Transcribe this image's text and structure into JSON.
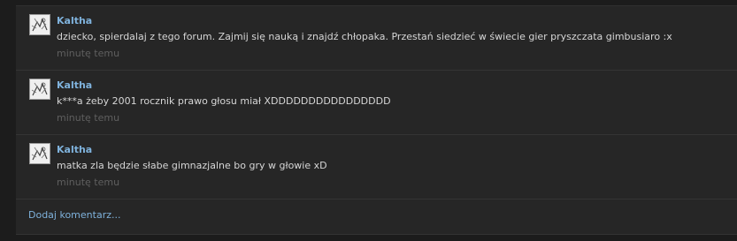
{
  "comments": [
    {
      "author": "Kaltha",
      "text": "dziecko, spierdalaj z tego forum. Zajmij się nauką i znajdź chłopaka. Przestań siedzieć w świecie gier pryszczata gimbusiaro :x",
      "time": "minutę temu"
    },
    {
      "author": "Kaltha",
      "text": "k***a żeby 2001 rocznik prawo głosu miał XDDDDDDDDDDDDDDDD",
      "time": "minutę temu"
    },
    {
      "author": "Kaltha",
      "text": "matka zla będzie słabe gimnazjalne bo gry w głowie xD",
      "time": "minutę temu"
    }
  ],
  "add_comment_label": "Dodaj komentarz...",
  "colors": {
    "background": "#1c1c1c",
    "panel": "#262626",
    "author_link": "#7fb2dc",
    "text": "#d6d6d6",
    "timestamp": "#5f5f5f"
  },
  "icons": {
    "avatar": "sketch-avatar-icon"
  }
}
